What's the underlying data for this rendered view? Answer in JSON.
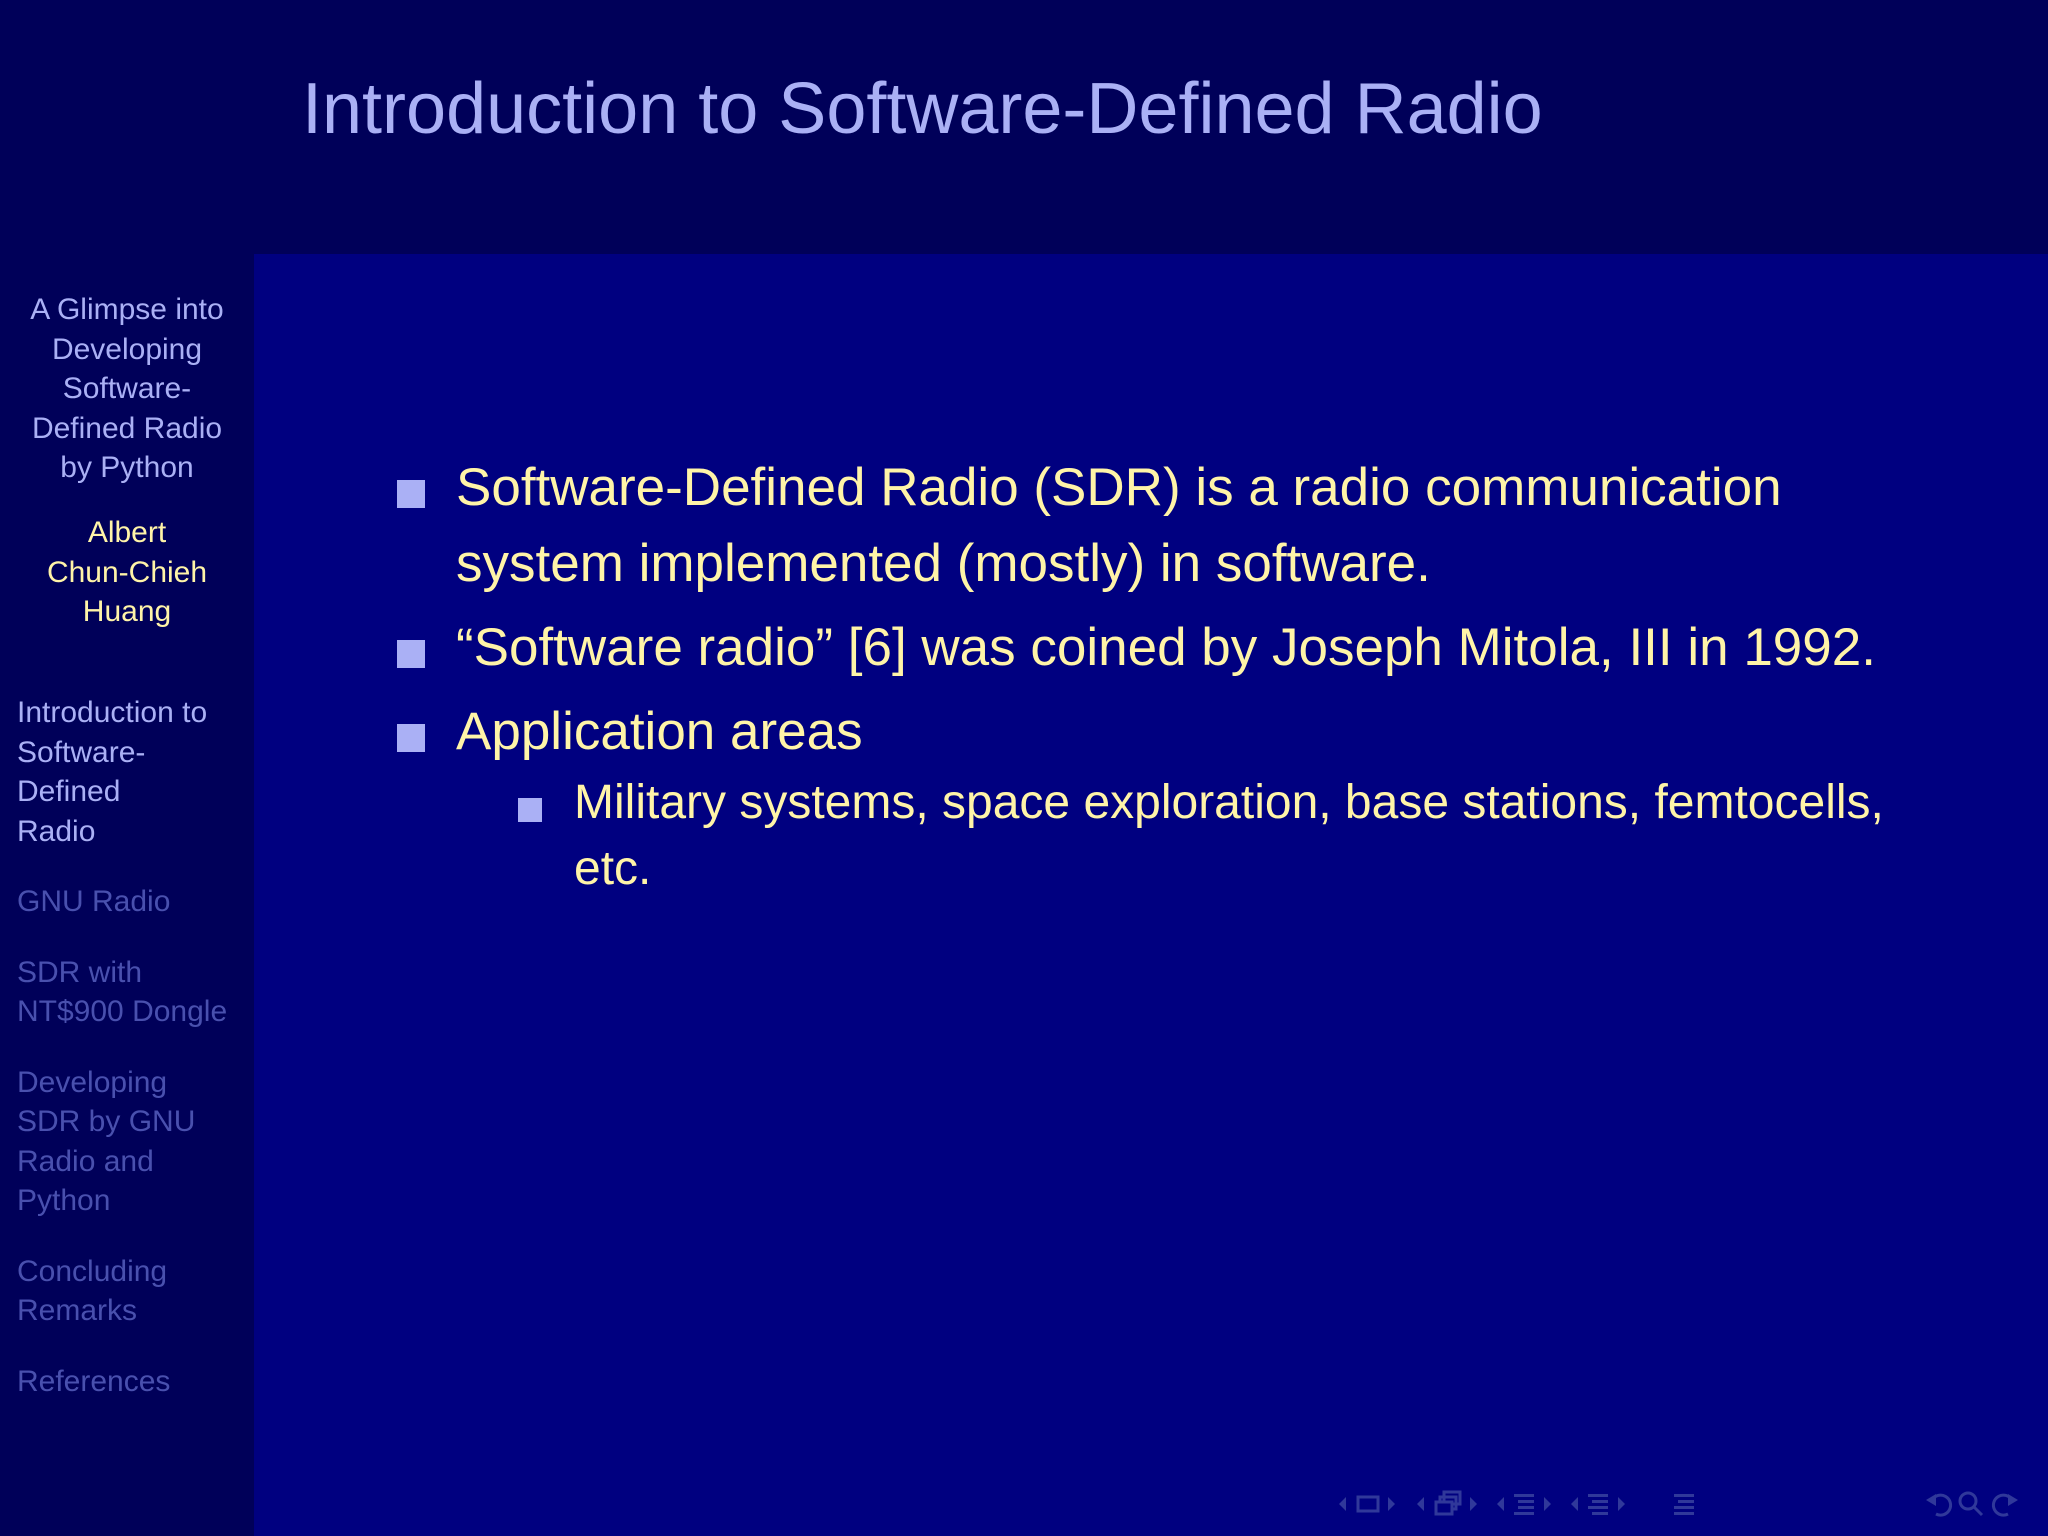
{
  "header": {
    "title": "Introduction to Software-Defined Radio"
  },
  "sidebar": {
    "talk_title": [
      "A Glimpse into",
      "Developing",
      "Software-",
      "Defined Radio",
      "by Python"
    ],
    "author": [
      "Albert",
      "Chun-Chieh",
      "Huang"
    ],
    "sections": [
      {
        "label_lines": [
          "Introduction to",
          "Software-",
          "Defined",
          "Radio"
        ],
        "active": true
      },
      {
        "label_lines": [
          "GNU Radio"
        ],
        "active": false
      },
      {
        "label_lines": [
          "SDR with",
          "NT$900 Dongle"
        ],
        "active": false
      },
      {
        "label_lines": [
          "Developing",
          "SDR by GNU",
          "Radio and",
          "Python"
        ],
        "active": false
      },
      {
        "label_lines": [
          "Concluding",
          "Remarks"
        ],
        "active": false
      },
      {
        "label_lines": [
          "References"
        ],
        "active": false
      }
    ]
  },
  "content": {
    "bullets": [
      {
        "lines": [
          "Software-Defined Radio (SDR) is a radio communication",
          "system implemented (mostly) in software."
        ]
      },
      {
        "lines": [
          "“Software radio” [6] was coined by Joseph Mitola, III in 1992."
        ]
      },
      {
        "lines": [
          "Application areas"
        ],
        "sub": [
          {
            "lines": [
              "Military systems, space exploration, base stations, femtocells,",
              "etc."
            ]
          }
        ]
      }
    ]
  },
  "colors": {
    "background": "#000080",
    "sidebar": "#000059",
    "title": "#aab0f5",
    "text": "#fff4a8",
    "inactive_section": "#4950ae"
  },
  "navigation_icons": [
    "prev-frame-icon",
    "frame-icon",
    "next-frame-icon",
    "prev-slide-icon",
    "slide-icon",
    "next-slide-icon",
    "prev-subsection-icon",
    "subsection-icon",
    "next-subsection-icon",
    "prev-section-icon",
    "section-icon",
    "next-section-icon",
    "document-icon",
    "back-icon",
    "search-icon",
    "forward-icon"
  ]
}
